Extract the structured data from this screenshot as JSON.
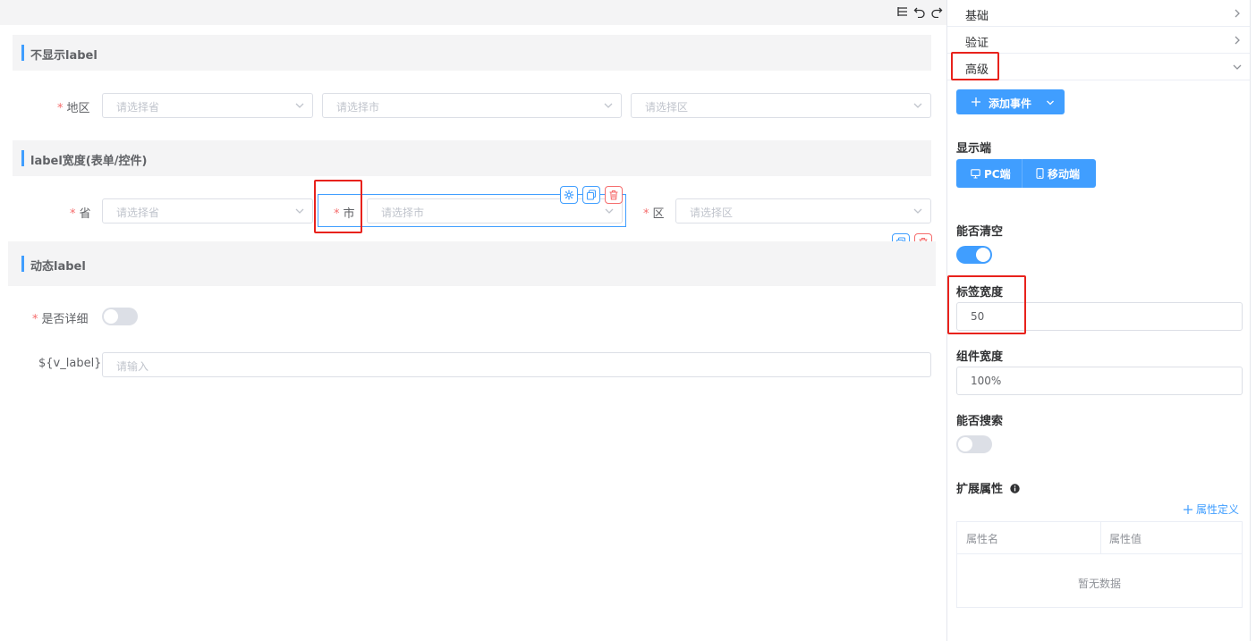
{
  "canvas": {
    "sections": [
      {
        "title": "不显示label"
      },
      {
        "title": "label宽度(表单/控件)"
      },
      {
        "title": "动态label"
      }
    ],
    "region_row": {
      "label": "地区",
      "selects": [
        "请选择省",
        "请选择市",
        "请选择区"
      ]
    },
    "width_row": {
      "province_label": "省",
      "province_placeholder": "请选择省",
      "city_label": "市",
      "city_placeholder": "请选择市",
      "district_label": "区",
      "district_placeholder": "请选择区"
    },
    "dynamic": {
      "detail_label": "是否详细",
      "detail_switch_on": false,
      "var_label": "${v_label}",
      "var_placeholder": "请输入"
    }
  },
  "panel": {
    "accordion": [
      {
        "label": "基础",
        "expanded": false
      },
      {
        "label": "验证",
        "expanded": false
      },
      {
        "label": "高级",
        "expanded": true
      }
    ],
    "add_event_label": "添加事件",
    "display_title": "显示端",
    "display_options": [
      "PC端",
      "移动端"
    ],
    "clearable_title": "能否清空",
    "clearable_on": true,
    "label_width_title": "标签宽度",
    "label_width_value": "50",
    "component_width_title": "组件宽度",
    "component_width_value": "100%",
    "searchable_title": "能否搜索",
    "searchable_on": false,
    "ext_title": "扩展属性",
    "ext_add_label": "属性定义",
    "ext_columns": [
      "属性名",
      "属性值"
    ],
    "ext_empty": "暂无数据"
  },
  "colors": {
    "primary": "#409eff",
    "danger": "#f56c6c",
    "highlight": "#e8221c"
  }
}
